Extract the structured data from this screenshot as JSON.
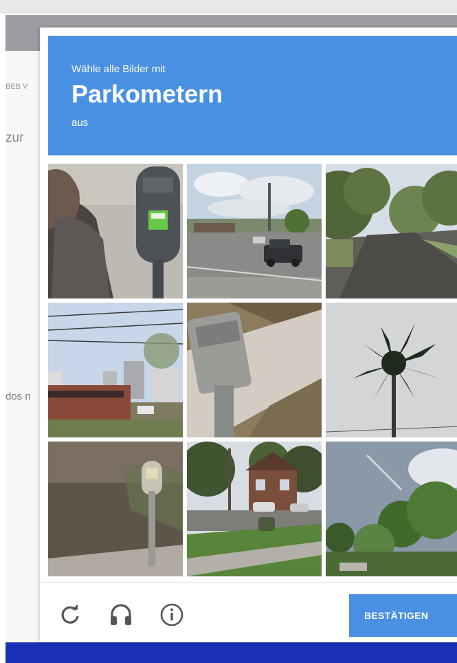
{
  "background_page": {
    "snippet_1": "BEB V",
    "snippet_2": "zur",
    "snippet_3": "dos n"
  },
  "challenge": {
    "instruction_prefix": "Wähle alle Bilder mit",
    "keyword": "Parkometern",
    "instruction_suffix": "aus",
    "tiles": [
      {
        "id": 1,
        "scene": "parking-meter-closeup-with-person"
      },
      {
        "id": 2,
        "scene": "street-with-truck-and-shops"
      },
      {
        "id": 3,
        "scene": "tree-lined-street"
      },
      {
        "id": 4,
        "scene": "storefronts-and-power-lines"
      },
      {
        "id": 5,
        "scene": "parking-meter-head-on-curb"
      },
      {
        "id": 6,
        "scene": "palm-tree-against-sky"
      },
      {
        "id": 7,
        "scene": "parking-meter-on-sidewalk"
      },
      {
        "id": 8,
        "scene": "residential-street-with-houses"
      },
      {
        "id": 9,
        "scene": "trees-and-sky"
      }
    ],
    "footer": {
      "reload_icon": "reload-icon",
      "audio_icon": "headphones-icon",
      "info_icon": "info-icon",
      "confirm_label": "BESTÄTIGEN"
    }
  },
  "colors": {
    "accent": "#4a90e2",
    "page_footer_bar": "#1a2fb8",
    "page_header_bar": "#9c9ca2"
  }
}
